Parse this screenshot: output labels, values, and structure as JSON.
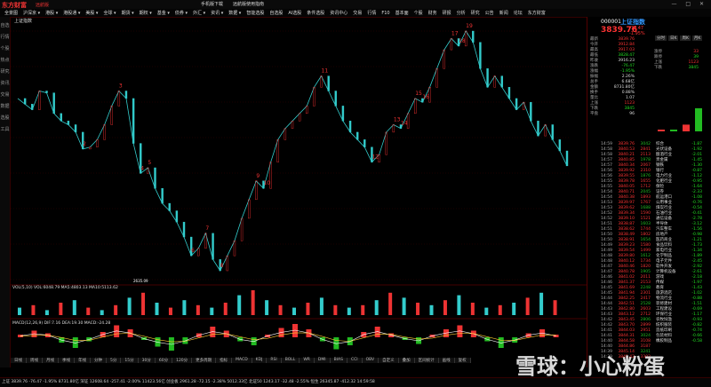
{
  "app": {
    "logo": "东方财富",
    "logo_sub": "远航版",
    "window_controls": "— □ ✕",
    "menu": [
      "全景图",
      "沪深京 ▾",
      "港股 ▾",
      "港股通 ▾",
      "美股 ▾",
      "全球 ▾",
      "期货 ▾",
      "期权 ▾",
      "基金 ▾",
      "债券 ▾",
      "外汇 ▾",
      "资讯 ▾",
      "数据 ▾",
      "智能选股",
      "自选股",
      "AI选股",
      "条件选股",
      "资讯中心",
      "交易",
      "行情",
      "F10",
      "基本面",
      "个股",
      "财务",
      "研报",
      "分析",
      "研究",
      "公告",
      "新闻",
      "论坛",
      "东方财富"
    ],
    "toolbar_button_1": "手机版下载",
    "toolbar_button_2": "远航版使用指南"
  },
  "sidebar": [
    "自选",
    "行情",
    "个股",
    "热点",
    "研究",
    "资讯",
    "交易",
    "数据",
    "选股",
    "工具"
  ],
  "chart_title": "上证指数",
  "chart_data": {
    "type": "line",
    "title": "",
    "xlabel": "",
    "ylabel": "",
    "price_series": [
      3120,
      3105,
      3090,
      3140,
      3135,
      3080,
      3060,
      3050,
      3030,
      2985,
      2990,
      3010,
      3050,
      3100,
      3140,
      3120,
      3000,
      2920,
      2935,
      2880,
      2840,
      2820,
      2790,
      2750,
      2700,
      2720,
      2760,
      2690,
      2660,
      2700,
      2740,
      2800,
      2850,
      2900,
      2880,
      2950,
      3010,
      3040,
      3060,
      3080,
      3100,
      3150,
      3180,
      3140,
      3100,
      3060,
      3030,
      3010,
      2990,
      2950,
      2970,
      3030,
      3050,
      3040,
      3080,
      3120,
      3110,
      3150,
      3200,
      3250,
      3280,
      3260,
      3300,
      3270,
      3200,
      3150,
      3180,
      3150,
      3120,
      3090,
      3110,
      3060,
      3020,
      3050,
      3010,
      2980,
      2940
    ],
    "wave_labels": [
      "2",
      "3",
      "4",
      "5",
      "6",
      "7",
      "8",
      "9",
      "10",
      "11",
      "12",
      "13",
      "14",
      "15",
      "16",
      "17",
      "18",
      "19"
    ],
    "low_annotation": "2635.09",
    "macd_hist": [
      0.2,
      0.5,
      0.3,
      -0.4,
      -0.8,
      -0.3,
      0.4,
      0.9,
      0.6,
      -0.2,
      -0.7,
      -1.0,
      -0.5,
      0.3,
      0.8,
      0.5,
      -0.3,
      -0.6,
      0.2,
      0.7,
      1.0,
      0.6,
      -0.3,
      -0.9,
      -0.6,
      0.4,
      0.8,
      0.3,
      -0.2,
      -0.5,
      0.2,
      0.6,
      0.9,
      0.5,
      -0.3,
      -0.8,
      -0.4,
      0.3,
      0.6,
      0.2
    ],
    "volume": [
      3,
      4,
      2,
      5,
      6,
      3,
      2,
      4,
      7,
      9,
      5,
      3,
      6,
      4,
      3,
      5,
      8,
      10,
      6,
      4,
      3,
      5,
      7,
      4,
      3,
      4,
      6,
      9,
      7,
      5,
      4,
      6,
      8,
      5,
      3,
      4,
      5,
      7,
      9,
      6
    ]
  },
  "indicators": {
    "vol_label": "VOL(5,10) VOL:6048.79  MA5:4803.13  MA10:5113.62",
    "macd_label": "MACD(12,26,9) DIF:7.16  DEA:19.30  MACD:-24.28"
  },
  "stock": {
    "code": "000001",
    "name": "上证指数",
    "price": "3839.76",
    "change": "-76.47",
    "pct": "-1.95%"
  },
  "quote_rows": [
    {
      "label": "最新",
      "value": "3839.76",
      "color": "r"
    },
    {
      "label": "今开",
      "value": "3912.84",
      "color": "r"
    },
    {
      "label": "最高",
      "value": "3917.03",
      "color": "r"
    },
    {
      "label": "最低",
      "value": "3828.47",
      "color": "g"
    },
    {
      "label": "昨收",
      "value": "3916.23",
      "color": "w"
    },
    {
      "label": "涨跌",
      "value": "-76.47",
      "color": "g"
    },
    {
      "label": "涨幅",
      "value": "-1.95%",
      "color": "g"
    },
    {
      "label": "振幅",
      "value": "2.26%",
      "color": "w"
    },
    {
      "label": "总手",
      "value": "6.68亿",
      "color": "w"
    },
    {
      "label": "金额",
      "value": "8731.80亿",
      "color": "w"
    },
    {
      "label": "换手",
      "value": "0.88%",
      "color": "w"
    },
    {
      "label": "量比",
      "value": "1.07",
      "color": "w"
    },
    {
      "label": "上涨",
      "value": "1123",
      "color": "r"
    },
    {
      "label": "下跌",
      "value": "3845",
      "color": "g"
    },
    {
      "label": "平盘",
      "value": "96",
      "color": "w"
    }
  ],
  "right_tabs": [
    "分时",
    "日K",
    "周K",
    "月K"
  ],
  "right_stats": [
    {
      "label": "涨停",
      "value": "33",
      "color": "r"
    },
    {
      "label": "跌停",
      "value": "39",
      "color": "g"
    },
    {
      "label": "上涨",
      "value": "1123",
      "color": "r"
    },
    {
      "label": "下跌",
      "value": "3845",
      "color": "g"
    }
  ],
  "ticks": [
    {
      "time": "14:59",
      "price": "3839.76",
      "vol": "3042"
    },
    {
      "time": "14:58",
      "price": "3840.53",
      "vol": "2841"
    },
    {
      "time": "14:58",
      "price": "3840.21",
      "vol": "2113"
    },
    {
      "time": "14:57",
      "price": "3840.85",
      "vol": "1978"
    },
    {
      "time": "14:57",
      "price": "3840.34",
      "vol": "2067"
    },
    {
      "time": "14:56",
      "price": "3839.92",
      "vol": "2310"
    },
    {
      "time": "14:56",
      "price": "3839.55",
      "vol": "1876"
    },
    {
      "time": "14:55",
      "price": "3839.78",
      "vol": "1655"
    },
    {
      "time": "14:55",
      "price": "3840.05",
      "vol": "1712"
    },
    {
      "time": "14:54",
      "price": "3840.71",
      "vol": "2045"
    },
    {
      "time": "14:54",
      "price": "3840.38",
      "vol": "1893"
    },
    {
      "time": "14:53",
      "price": "3839.97",
      "vol": "1767"
    },
    {
      "time": "14:53",
      "price": "3839.62",
      "vol": "1688"
    },
    {
      "time": "14:52",
      "price": "3839.34",
      "vol": "1590"
    },
    {
      "time": "14:52",
      "price": "3839.10",
      "vol": "1521"
    },
    {
      "time": "14:51",
      "price": "3838.87",
      "vol": "1603"
    },
    {
      "time": "14:51",
      "price": "3838.62",
      "vol": "1744"
    },
    {
      "time": "14:50",
      "price": "3838.49",
      "vol": "1802"
    },
    {
      "time": "14:50",
      "price": "3838.91",
      "vol": "1654"
    },
    {
      "time": "14:49",
      "price": "3839.23",
      "vol": "1580"
    },
    {
      "time": "14:49",
      "price": "3839.54",
      "vol": "1499"
    },
    {
      "time": "14:48",
      "price": "3839.80",
      "vol": "1612"
    },
    {
      "time": "14:48",
      "price": "3840.12",
      "vol": "1734"
    },
    {
      "time": "14:47",
      "price": "3840.46",
      "vol": "1820"
    },
    {
      "time": "14:47",
      "price": "3840.78",
      "vol": "1905"
    },
    {
      "time": "14:46",
      "price": "3841.02",
      "vol": "2011"
    },
    {
      "time": "14:46",
      "price": "3841.37",
      "vol": "2153"
    },
    {
      "time": "14:45",
      "price": "3841.69",
      "vol": "2248"
    },
    {
      "time": "14:45",
      "price": "3841.94",
      "vol": "2301"
    },
    {
      "time": "14:44",
      "price": "3842.25",
      "vol": "2417"
    },
    {
      "time": "14:44",
      "price": "3842.51",
      "vol": "2528"
    },
    {
      "time": "14:43",
      "price": "3842.80",
      "vol": "2603"
    },
    {
      "time": "14:43",
      "price": "3843.12",
      "vol": "2712"
    },
    {
      "time": "14:42",
      "price": "3843.45",
      "vol": "2806"
    },
    {
      "time": "14:42",
      "price": "3843.70",
      "vol": "2899"
    },
    {
      "time": "14:41",
      "price": "3844.03",
      "vol": "2951"
    },
    {
      "time": "14:41",
      "price": "3844.31",
      "vol": "3024"
    },
    {
      "time": "14:40",
      "price": "3844.58",
      "vol": "3108"
    },
    {
      "time": "14:40",
      "price": "3844.86",
      "vol": "3187"
    },
    {
      "time": "14:39",
      "price": "3845.14",
      "vol": "3241"
    },
    {
      "time": "14:39",
      "price": "3845.42",
      "vol": "3302"
    }
  ],
  "sectors": [
    {
      "name": "综合",
      "chg": "-1.87",
      "pct": "-1.87",
      "color": "g"
    },
    {
      "name": "光伏设备",
      "chg": "-1.92",
      "pct": "-1.92",
      "color": "g"
    },
    {
      "name": "酿酒行业",
      "chg": "-2.01",
      "pct": "-2.01",
      "color": "g"
    },
    {
      "name": "贵金属",
      "chg": "-1.45",
      "pct": "-1.45",
      "color": "g"
    },
    {
      "name": "钢铁",
      "chg": "-1.30",
      "pct": "-1.30",
      "color": "g"
    },
    {
      "name": "银行",
      "chg": "-0.87",
      "pct": "-0.87",
      "color": "g"
    },
    {
      "name": "电力行业",
      "chg": "-1.12",
      "pct": "-1.12",
      "color": "g"
    },
    {
      "name": "化肥行业",
      "chg": "-0.95",
      "pct": "-0.95",
      "color": "g"
    },
    {
      "name": "保险",
      "chg": "-1.64",
      "pct": "-1.64",
      "color": "g"
    },
    {
      "name": "证券",
      "chg": "-2.33",
      "pct": "-2.33",
      "color": "g"
    },
    {
      "name": "航运港口",
      "chg": "-1.08",
      "pct": "-1.08",
      "color": "g"
    },
    {
      "name": "公用事业",
      "chg": "-0.76",
      "pct": "-0.76",
      "color": "g"
    },
    {
      "name": "煤炭行业",
      "chg": "-0.54",
      "pct": "-0.54",
      "color": "g"
    },
    {
      "name": "石油行业",
      "chg": "-0.41",
      "pct": "-0.41",
      "color": "g"
    },
    {
      "name": "通信设备",
      "chg": "-2.78",
      "pct": "-2.78",
      "color": "g"
    },
    {
      "name": "半导体",
      "chg": "-3.12",
      "pct": "-3.12",
      "color": "g"
    },
    {
      "name": "汽车整车",
      "chg": "-1.56",
      "pct": "-1.56",
      "color": "g"
    },
    {
      "name": "房地产",
      "chg": "-0.98",
      "pct": "-0.98",
      "color": "g"
    },
    {
      "name": "医药商业",
      "chg": "-1.21",
      "pct": "-1.21",
      "color": "g"
    },
    {
      "name": "食品饮料",
      "chg": "-1.73",
      "pct": "-1.73",
      "color": "g"
    },
    {
      "name": "家电行业",
      "chg": "-1.34",
      "pct": "-1.34",
      "color": "g"
    },
    {
      "name": "化学制品",
      "chg": "-1.89",
      "pct": "-1.89",
      "color": "g"
    },
    {
      "name": "电子元件",
      "chg": "-2.45",
      "pct": "-2.45",
      "color": "g"
    },
    {
      "name": "软件开发",
      "chg": "-2.92",
      "pct": "-2.92",
      "color": "g"
    },
    {
      "name": "计算机设备",
      "chg": "-2.61",
      "pct": "-2.61",
      "color": "g"
    },
    {
      "name": "游戏",
      "chg": "-2.18",
      "pct": "-2.18",
      "color": "g"
    },
    {
      "name": "传媒",
      "chg": "-1.97",
      "pct": "-1.97",
      "color": "g"
    },
    {
      "name": "教育",
      "chg": "-1.43",
      "pct": "-1.43",
      "color": "g"
    },
    {
      "name": "旅游酒店",
      "chg": "-1.02",
      "pct": "-1.02",
      "color": "g"
    },
    {
      "name": "物流行业",
      "chg": "-0.88",
      "pct": "-0.88",
      "color": "g"
    },
    {
      "name": "装修建材",
      "chg": "-1.51",
      "pct": "-1.51",
      "color": "g"
    },
    {
      "name": "工程建设",
      "chg": "-0.69",
      "pct": "-0.69",
      "color": "g"
    },
    {
      "name": "环保行业",
      "chg": "-1.17",
      "pct": "-1.17",
      "color": "g"
    },
    {
      "name": "农牧饲渔",
      "chg": "-0.93",
      "pct": "-0.93",
      "color": "g"
    },
    {
      "name": "纺织服装",
      "chg": "-0.82",
      "pct": "-0.82",
      "color": "g"
    },
    {
      "name": "造纸印刷",
      "chg": "-0.74",
      "pct": "-0.74",
      "color": "g"
    },
    {
      "name": "包装材料",
      "chg": "-0.66",
      "pct": "-0.66",
      "color": "g"
    },
    {
      "name": "橡胶制品",
      "chg": "-0.58",
      "pct": "-0.58",
      "color": "g"
    }
  ],
  "bottom_tabs": [
    "日线",
    "周线",
    "月线",
    "季线",
    "年线",
    "分钟",
    "5分",
    "15分",
    "30分",
    "60分",
    "120分",
    "更多周期",
    "指标",
    "MACD",
    "KDJ",
    "RSI",
    "BOLL",
    "WR",
    "DMI",
    "BIAS",
    "CCI",
    "OBV",
    "自定义",
    "叠加",
    "区间统计",
    "画线",
    "复权"
  ],
  "status_text": "上证 3839.76 -76.47 -1.95% 8731.80亿   深证 12608.64 -257.41 -2.00% 11423.56亿   创业板 2961.28 -72.15 -2.38% 5012.33亿   北证50 1243.17 -32.48 -2.55%   恒生 26345.87 -412.32   14:59:58",
  "watermark": "雪球：小心粉蛋"
}
